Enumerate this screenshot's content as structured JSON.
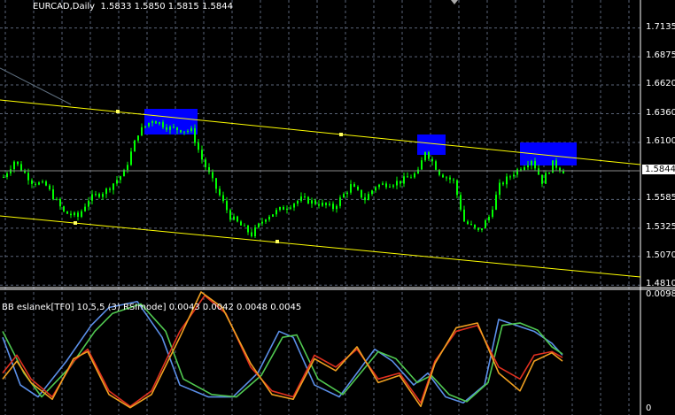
{
  "header": {
    "symbol": "EURCAD,Daily",
    "ohlc": "1.5833 1.5850 1.5815 1.5844"
  },
  "price_axis": {
    "ticks": [
      "1.7135",
      "1.6875",
      "1.6620",
      "1.6360",
      "1.6100",
      "1.5585",
      "1.5325",
      "1.5070",
      "1.4810"
    ],
    "tick_values": [
      1.7135,
      1.6875,
      1.662,
      1.636,
      1.61,
      1.5585,
      1.5325,
      1.507,
      1.481
    ],
    "bid_label": "1.5844",
    "bid": 1.5844
  },
  "indicator": {
    "title": "BB  eslanek[TF0] 10,5,5 (3) RSImode]",
    "values": "0.0043 0.0042 0.0048 0.0045",
    "axis_max": "0.0098",
    "axis_min": "0",
    "series": [
      {
        "name": "blue",
        "color": "#5b8fe8",
        "points": [
          [
            0,
            0.006
          ],
          [
            5,
            0.002
          ],
          [
            10,
            0.001
          ],
          [
            18,
            0.004
          ],
          [
            25,
            0.007
          ],
          [
            30,
            0.0085
          ],
          [
            38,
            0.009
          ],
          [
            45,
            0.006
          ],
          [
            50,
            0.002
          ],
          [
            58,
            0.001
          ],
          [
            65,
            0.001
          ],
          [
            72,
            0.003
          ],
          [
            78,
            0.0065
          ],
          [
            82,
            0.006
          ],
          [
            88,
            0.002
          ],
          [
            95,
            0.001
          ],
          [
            100,
            0.003
          ],
          [
            105,
            0.005
          ],
          [
            110,
            0.004
          ],
          [
            116,
            0.002
          ],
          [
            120,
            0.003
          ],
          [
            125,
            0.001
          ],
          [
            130,
            0.0005
          ],
          [
            136,
            0.002
          ],
          [
            140,
            0.0075
          ],
          [
            145,
            0.007
          ],
          [
            150,
            0.0065
          ],
          [
            155,
            0.0055
          ],
          [
            158,
            0.0045
          ]
        ]
      },
      {
        "name": "green",
        "color": "#50c850",
        "points": [
          [
            0,
            0.0065
          ],
          [
            6,
            0.003
          ],
          [
            11,
            0.001
          ],
          [
            19,
            0.0035
          ],
          [
            26,
            0.0065
          ],
          [
            31,
            0.008
          ],
          [
            39,
            0.0088
          ],
          [
            46,
            0.0065
          ],
          [
            51,
            0.0025
          ],
          [
            59,
            0.0012
          ],
          [
            66,
            0.001
          ],
          [
            73,
            0.0028
          ],
          [
            79,
            0.006
          ],
          [
            83,
            0.0062
          ],
          [
            89,
            0.0025
          ],
          [
            96,
            0.0012
          ],
          [
            101,
            0.003
          ],
          [
            106,
            0.0048
          ],
          [
            111,
            0.0042
          ],
          [
            117,
            0.0022
          ],
          [
            121,
            0.0028
          ],
          [
            126,
            0.0012
          ],
          [
            131,
            0.0006
          ],
          [
            137,
            0.0022
          ],
          [
            141,
            0.007
          ],
          [
            146,
            0.0072
          ],
          [
            151,
            0.0066
          ],
          [
            155,
            0.0052
          ],
          [
            158,
            0.0046
          ]
        ]
      },
      {
        "name": "red",
        "color": "#e03020",
        "points": [
          [
            0,
            0.003
          ],
          [
            4,
            0.0045
          ],
          [
            8,
            0.0025
          ],
          [
            14,
            0.001
          ],
          [
            20,
            0.004
          ],
          [
            24,
            0.005
          ],
          [
            30,
            0.0015
          ],
          [
            36,
            0.0002
          ],
          [
            42,
            0.0015
          ],
          [
            50,
            0.0065
          ],
          [
            57,
            0.0095
          ],
          [
            63,
            0.008
          ],
          [
            70,
            0.0035
          ],
          [
            76,
            0.0015
          ],
          [
            82,
            0.001
          ],
          [
            88,
            0.0045
          ],
          [
            94,
            0.0035
          ],
          [
            100,
            0.005
          ],
          [
            106,
            0.0025
          ],
          [
            112,
            0.003
          ],
          [
            118,
            0.0005
          ],
          [
            122,
            0.004
          ],
          [
            128,
            0.0065
          ],
          [
            134,
            0.007
          ],
          [
            140,
            0.0035
          ],
          [
            146,
            0.0025
          ],
          [
            150,
            0.0045
          ],
          [
            155,
            0.0048
          ],
          [
            158,
            0.0043
          ]
        ]
      },
      {
        "name": "orange",
        "color": "#f0a020",
        "points": [
          [
            0,
            0.0025
          ],
          [
            4,
            0.004
          ],
          [
            8,
            0.0022
          ],
          [
            14,
            0.0008
          ],
          [
            20,
            0.0042
          ],
          [
            24,
            0.0048
          ],
          [
            30,
            0.0012
          ],
          [
            36,
            0.0001
          ],
          [
            42,
            0.0012
          ],
          [
            50,
            0.006
          ],
          [
            56,
            0.0098
          ],
          [
            62,
            0.0085
          ],
          [
            70,
            0.0038
          ],
          [
            76,
            0.0012
          ],
          [
            82,
            0.0008
          ],
          [
            88,
            0.0042
          ],
          [
            94,
            0.0032
          ],
          [
            100,
            0.0052
          ],
          [
            106,
            0.0022
          ],
          [
            112,
            0.0028
          ],
          [
            118,
            0.0002
          ],
          [
            122,
            0.0038
          ],
          [
            128,
            0.0068
          ],
          [
            134,
            0.0072
          ],
          [
            140,
            0.003
          ],
          [
            146,
            0.0015
          ],
          [
            150,
            0.004
          ],
          [
            155,
            0.0047
          ],
          [
            158,
            0.004
          ]
        ]
      }
    ]
  },
  "price_keypoints": [
    [
      0,
      1.5788
    ],
    [
      3,
      1.5932
    ],
    [
      8,
      1.5748
    ],
    [
      12,
      1.5708
    ],
    [
      17,
      1.5468
    ],
    [
      21,
      1.5428
    ],
    [
      24,
      1.5588
    ],
    [
      29,
      1.5668
    ],
    [
      34,
      1.5828
    ],
    [
      38,
      1.6188
    ],
    [
      42,
      1.6308
    ],
    [
      47,
      1.6228
    ],
    [
      53,
      1.6204
    ],
    [
      56,
      1.5948
    ],
    [
      59,
      1.5748
    ],
    [
      64,
      1.5428
    ],
    [
      70,
      1.5268
    ],
    [
      74,
      1.5428
    ],
    [
      79,
      1.5508
    ],
    [
      84,
      1.5588
    ],
    [
      89,
      1.5548
    ],
    [
      93,
      1.5508
    ],
    [
      98,
      1.5708
    ],
    [
      102,
      1.5588
    ],
    [
      105,
      1.5708
    ],
    [
      112,
      1.5748
    ],
    [
      117,
      1.5828
    ],
    [
      119,
      1.6028
    ],
    [
      123,
      1.5828
    ],
    [
      127,
      1.5748
    ],
    [
      130,
      1.5388
    ],
    [
      134,
      1.5292
    ],
    [
      137,
      1.5428
    ],
    [
      140,
      1.5708
    ],
    [
      144,
      1.5828
    ],
    [
      149,
      1.5948
    ],
    [
      152,
      1.5748
    ],
    [
      155,
      1.5908
    ],
    [
      158,
      1.5844
    ]
  ],
  "objects": {
    "trendlines": [
      {
        "color": "#ffff00",
        "from": 1.6484,
        "to": 1.59
      },
      {
        "color": "#ffff00",
        "from": 1.5436,
        "to": 1.4884
      }
    ],
    "rectangles": [
      {
        "color": "#0000ff",
        "bars": [
          40,
          55
        ],
        "prices": [
          1.6404,
          1.6172
        ]
      },
      {
        "color": "#0000ff",
        "bars": [
          117,
          125
        ],
        "prices": [
          1.6172,
          1.5988
        ]
      },
      {
        "color": "#0000ff",
        "bars": [
          146,
          162
        ],
        "prices": [
          1.61,
          1.5892
        ]
      }
    ]
  }
}
